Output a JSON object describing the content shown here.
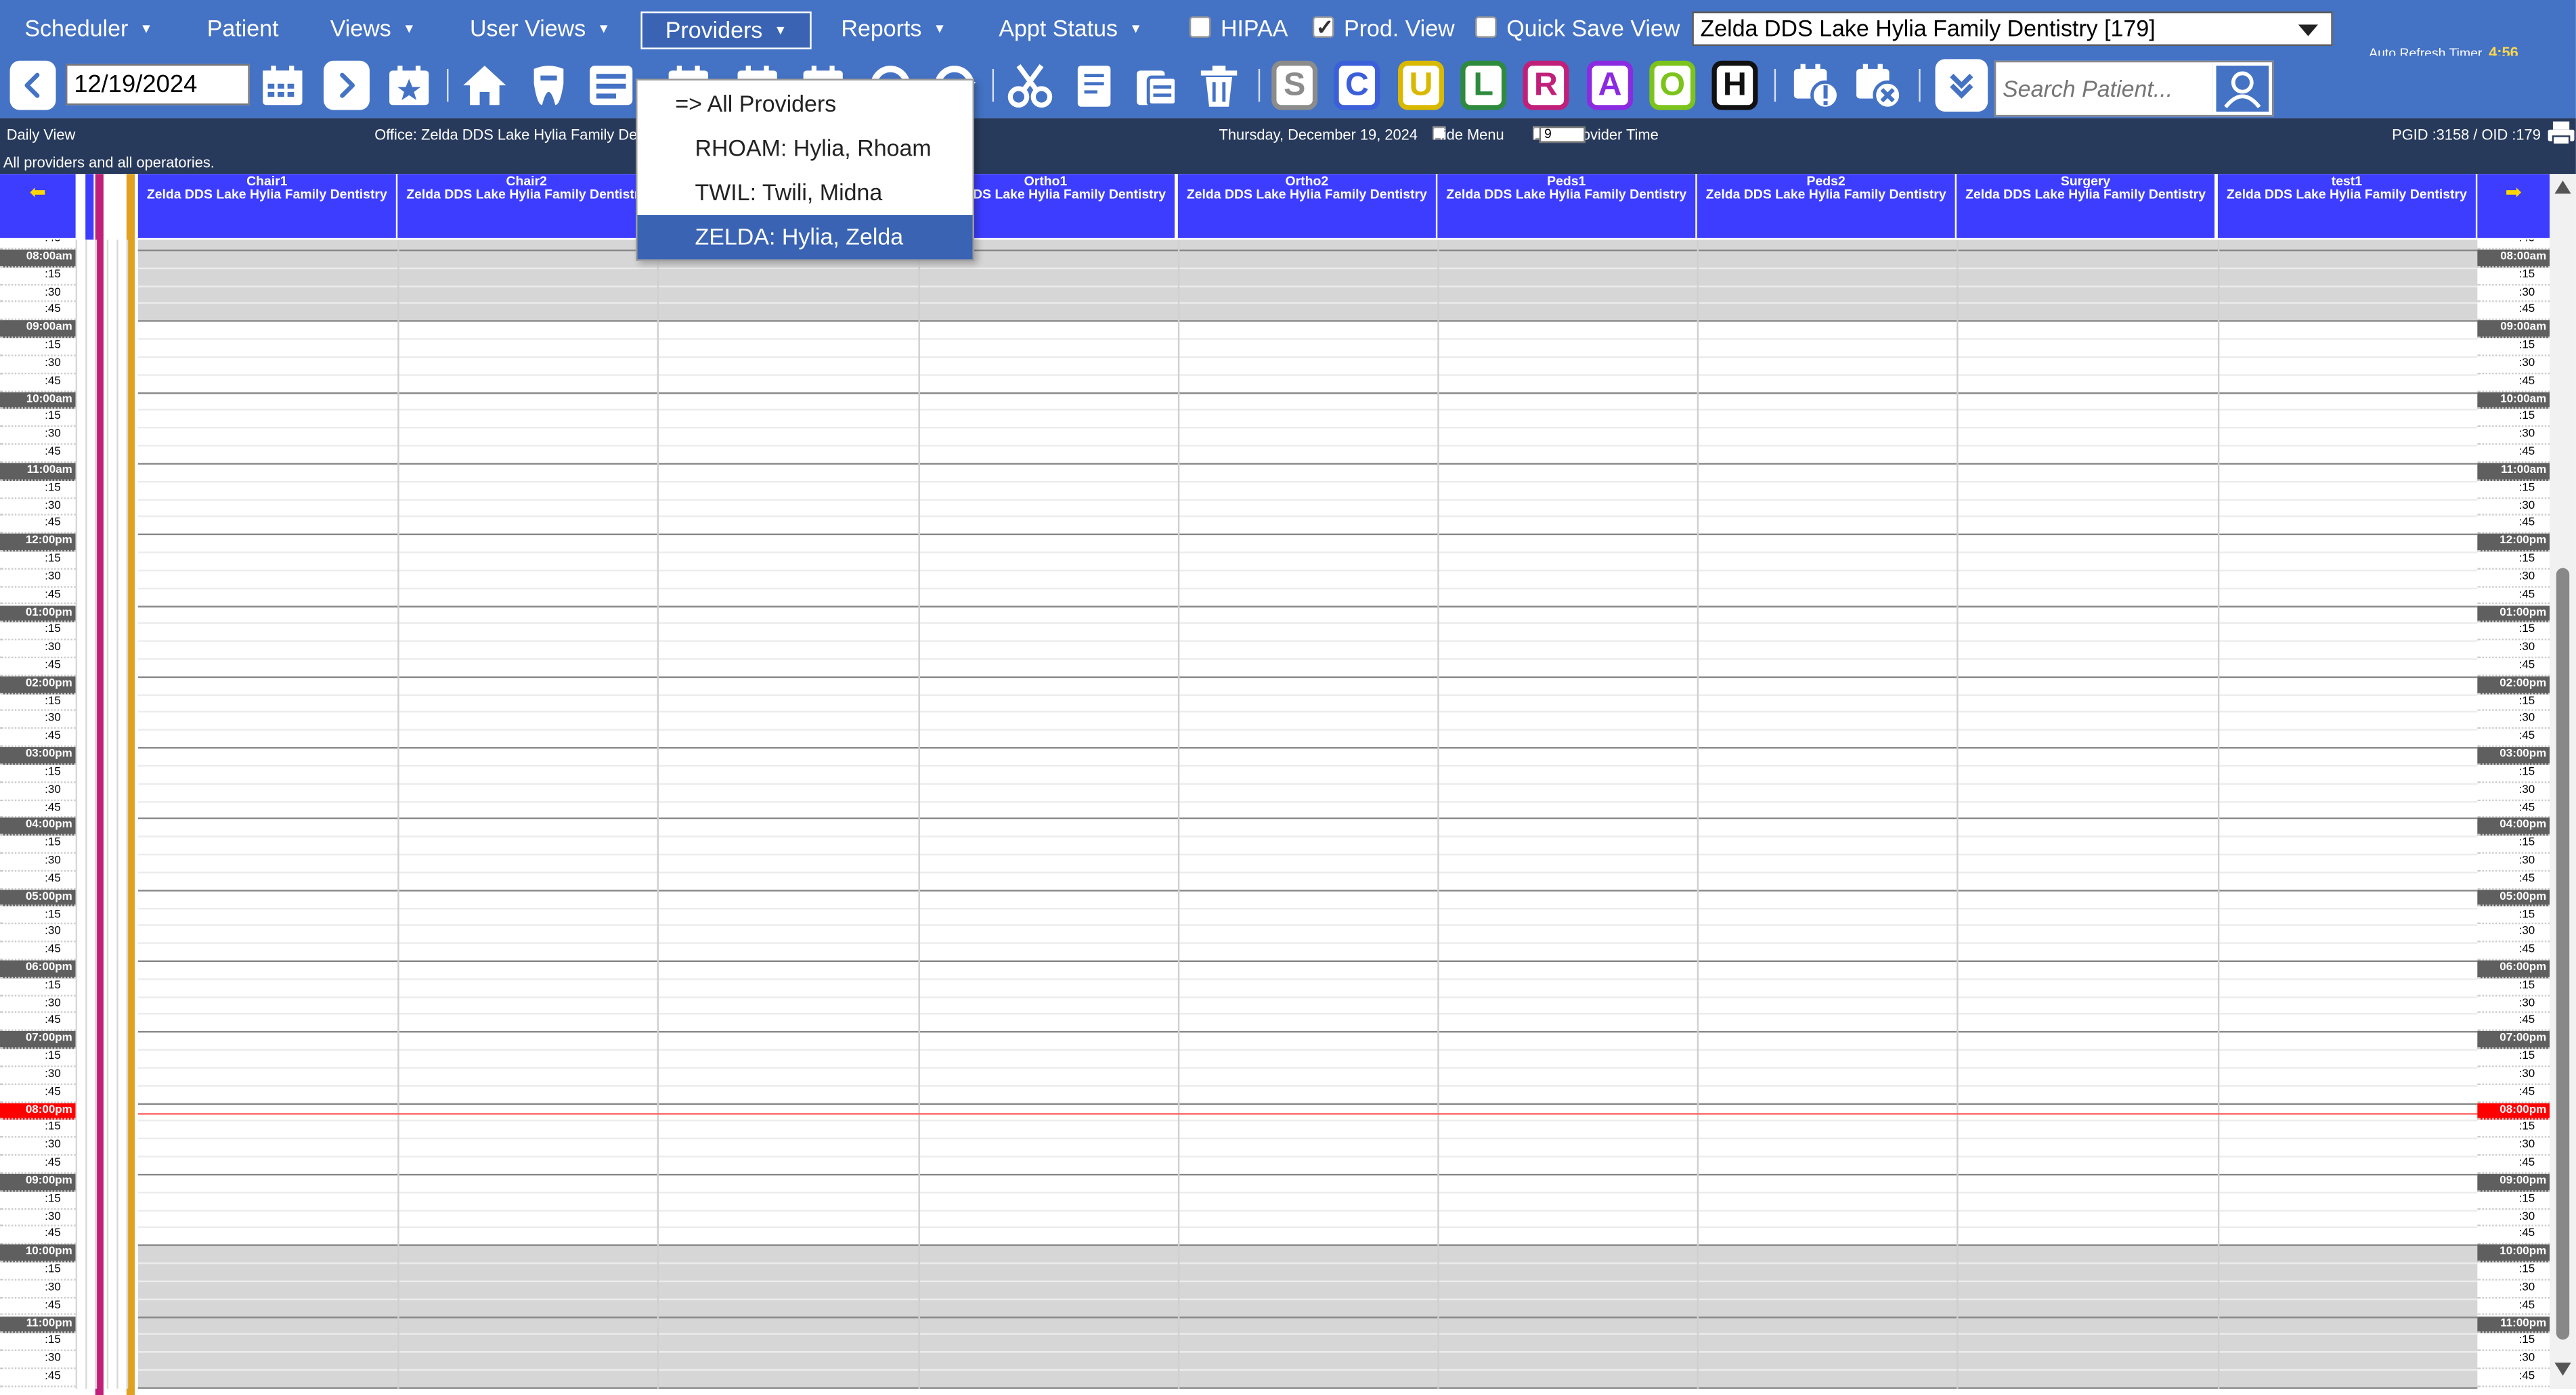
{
  "menubar": {
    "scheduler": "Scheduler",
    "patient": "Patient",
    "views": "Views",
    "user_views": "User Views",
    "providers": "Providers",
    "reports": "Reports",
    "appt_status": "Appt Status",
    "hipaa_label": "HIPAA",
    "hipaa_checked": false,
    "prod_view_label": "Prod. View",
    "prod_view_checked": true,
    "quick_save_label": "Quick Save View",
    "quick_save_checked": false,
    "office_selected": "Zelda DDS Lake Hylia Family Dentistry [179]",
    "refresh_label": "Auto Refresh Timer",
    "refresh_value": "4:56"
  },
  "toolbar": {
    "date_value": "12/19/2024",
    "search_placeholder": "Search Patient...",
    "letters": [
      {
        "letter": "S",
        "color": "#8c8c8c"
      },
      {
        "letter": "C",
        "color": "#3b5fd9"
      },
      {
        "letter": "U",
        "color": "#d9b800"
      },
      {
        "letter": "L",
        "color": "#2e8b3d"
      },
      {
        "letter": "R",
        "color": "#c0207a"
      },
      {
        "letter": "A",
        "color": "#8a2be2"
      },
      {
        "letter": "O",
        "color": "#7cc41c"
      },
      {
        "letter": "H",
        "color": "#111111"
      }
    ]
  },
  "infobar": {
    "view_name": "Daily View",
    "office": "Office: Zelda DDS Lake Hylia Family Dentistry",
    "date_long": "Thursday, December 19, 2024",
    "hide_menu": "Hide Menu",
    "hide_provider_time": "Hide Provider Time",
    "interval": "9",
    "ids": "PGID :3158  /  OID :179",
    "subtitle": "All providers and all operatories."
  },
  "columns": [
    {
      "name": "Chair1",
      "office": "Zelda DDS Lake Hylia Family Dentistry"
    },
    {
      "name": "Chair2",
      "office": "Zelda DDS Lake Hylia Family Dentistry"
    },
    {
      "name": "",
      "office": ""
    },
    {
      "name": "Ortho1",
      "office": "Zelda DDS Lake Hylia Family Dentistry"
    },
    {
      "name": "Ortho2",
      "office": "Zelda DDS Lake Hylia Family Dentistry"
    },
    {
      "name": "Peds1",
      "office": "Zelda DDS Lake Hylia Family Dentistry"
    },
    {
      "name": "Peds2",
      "office": "Zelda DDS Lake Hylia Family Dentistry"
    },
    {
      "name": "Surgery",
      "office": "Zelda DDS Lake Hylia Family Dentistry"
    },
    {
      "name": "test1",
      "office": "Zelda DDS Lake Hylia Family Dentistry"
    }
  ],
  "schedule": {
    "hours": [
      "08:00am",
      "09:00am",
      "10:00am",
      "11:00am",
      "12:00pm",
      "01:00pm",
      "02:00pm",
      "03:00pm",
      "04:00pm",
      "05:00pm",
      "06:00pm",
      "07:00pm",
      "08:00pm",
      "09:00pm",
      "10:00pm",
      "11:00pm"
    ],
    "quarters": [
      ":15",
      ":30",
      ":45"
    ],
    "current_hour": "08:00pm",
    "top_fragment": ":45"
  },
  "providers_dropdown": {
    "items": [
      {
        "label": "=> All Providers",
        "selected": false
      },
      {
        "label": "RHOAM: Hylia, Rhoam",
        "selected": false
      },
      {
        "label": "TWIL: Twili, Midna",
        "selected": false
      },
      {
        "label": "ZELDA: Hylia, Zelda",
        "selected": true
      }
    ]
  },
  "colors": {
    "menubar_bg": "#4472c4",
    "infobar_bg": "#283a5c",
    "column_header_bg": "#3d3dff",
    "hour_row_bg": "#5f5f5f",
    "current_time_row": "#ff0000",
    "closed_hours_bg": "#d6d6d6"
  }
}
